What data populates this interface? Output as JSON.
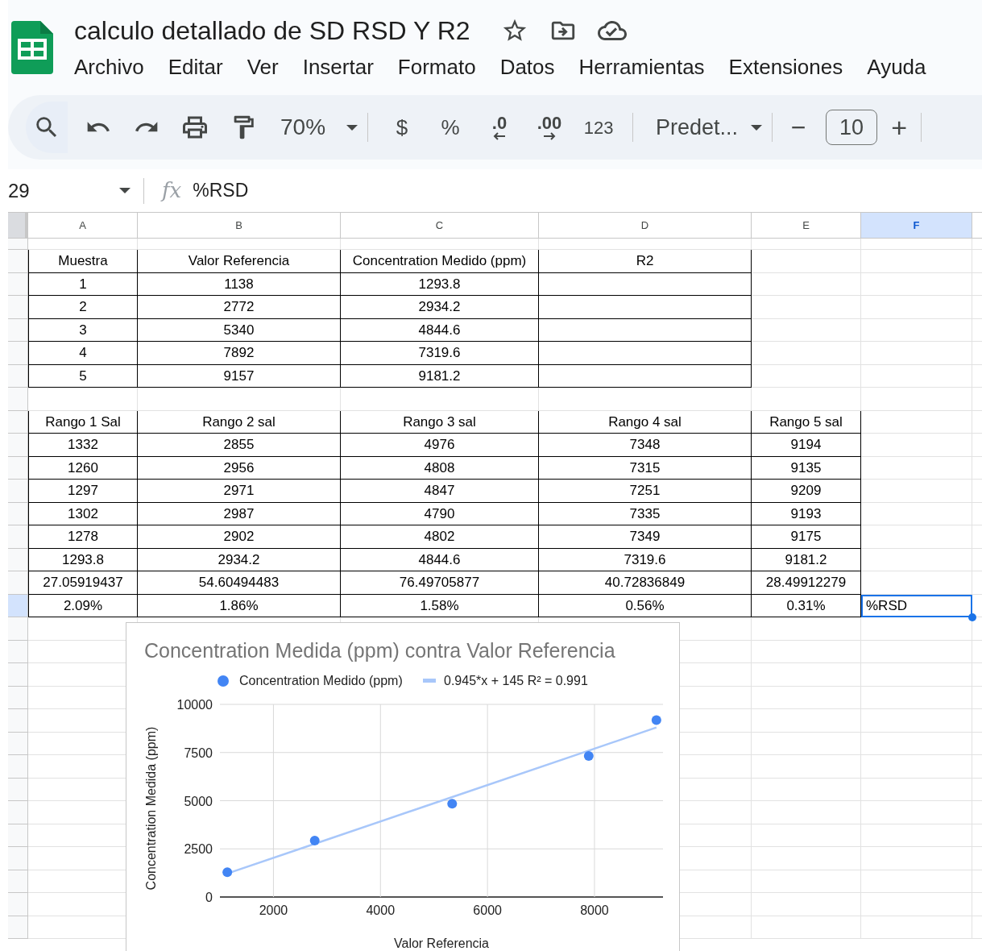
{
  "document": {
    "title": "calculo detallado de SD RSD Y R2"
  },
  "menu": [
    "Archivo",
    "Editar",
    "Ver",
    "Insertar",
    "Formato",
    "Datos",
    "Herramientas",
    "Extensiones",
    "Ayuda"
  ],
  "toolbar": {
    "zoom": "70%",
    "currency": "$",
    "percent": "%",
    "decrease_decimals": ".0",
    "increase_decimals": ".00",
    "number_format": "123",
    "font": "Predet...",
    "minus": "−",
    "font_size": "10",
    "plus": "+"
  },
  "formula_bar": {
    "cell_ref": "29",
    "fx": "fx",
    "value": "%RSD"
  },
  "sheet": {
    "columns": [
      {
        "label": "A",
        "selected": false
      },
      {
        "label": "B",
        "selected": false
      },
      {
        "label": "C",
        "selected": false
      },
      {
        "label": "D",
        "selected": false
      },
      {
        "label": "E",
        "selected": false
      },
      {
        "label": "F",
        "selected": true
      }
    ],
    "tables": [
      {
        "header": [
          "Muestra",
          "Valor Referencia",
          "Concentration Medido (ppm)",
          "R2"
        ],
        "rows": [
          {
            "cells": [
              "1",
              "1138",
              "1293.8",
              null
            ],
            "selected": false
          },
          {
            "cells": [
              "2",
              "2772",
              "2934.2",
              null
            ],
            "selected": false
          },
          {
            "cells": [
              "3",
              "5340",
              "4844.6",
              null
            ],
            "selected": false
          },
          {
            "cells": [
              "4",
              "7892",
              "7319.6",
              null
            ],
            "selected": false
          },
          {
            "cells": [
              "5",
              "9157",
              "9181.2",
              null
            ],
            "selected": false
          }
        ]
      },
      {
        "header": [
          "Rango 1 Sal",
          "Rango 2 sal",
          "Rango 3 sal",
          "Rango 4 sal",
          "Rango 5 sal"
        ],
        "rows": [
          {
            "cells": [
              "1332",
              "2855",
              "4976",
              "7348",
              "9194"
            ],
            "selected": false
          },
          {
            "cells": [
              "1260",
              "2956",
              "4808",
              "7315",
              "9135"
            ],
            "selected": false
          },
          {
            "cells": [
              "1297",
              "2971",
              "4847",
              "7251",
              "9209"
            ],
            "selected": false
          },
          {
            "cells": [
              "1302",
              "2987",
              "4790",
              "7335",
              "9193"
            ],
            "selected": false
          },
          {
            "cells": [
              "1278",
              "2902",
              "4802",
              "7349",
              "9175"
            ],
            "selected": false
          },
          {
            "cells": [
              "1293.8",
              "2934.2",
              "4844.6",
              "7319.6",
              "9181.2"
            ],
            "selected": false
          },
          {
            "cells": [
              "27.05919437",
              "54.60494483",
              "76.49705877",
              "40.72836849",
              "28.49912279"
            ],
            "selected": false
          },
          {
            "cells": [
              "2.09%",
              "1.86%",
              "1.58%",
              "0.56%",
              "0.31%"
            ],
            "selected": true,
            "cell_f": "%RSD"
          }
        ]
      }
    ]
  },
  "chart": {
    "chart_data": {
      "type": "scatter",
      "title": "Concentration Medida (ppm) contra Valor Referencia",
      "xlabel": "Valor Referencia",
      "ylabel": "Concentration Medida (ppm)",
      "x": [
        1138,
        2772,
        5340,
        7892,
        9157
      ],
      "series": [
        {
          "name": "Concentration Medido (ppm)",
          "color": "#4285f4",
          "type": "scatter",
          "values": [
            1290,
            2930,
            4840,
            7320,
            9180
          ]
        },
        {
          "name": "0.945*x + 145 R² = 0.991",
          "color": "#a8c7fa",
          "type": "line",
          "values": [
            1220,
            2760,
            5190,
            7600,
            8800
          ]
        }
      ],
      "grid": true,
      "legend": "top",
      "xlim": [
        1000,
        9280
      ],
      "ylim": [
        0,
        10000
      ],
      "xticks": [
        2000,
        4000,
        6000,
        8000
      ],
      "yticks": [
        0,
        2500,
        5000,
        7500,
        10000
      ]
    }
  }
}
